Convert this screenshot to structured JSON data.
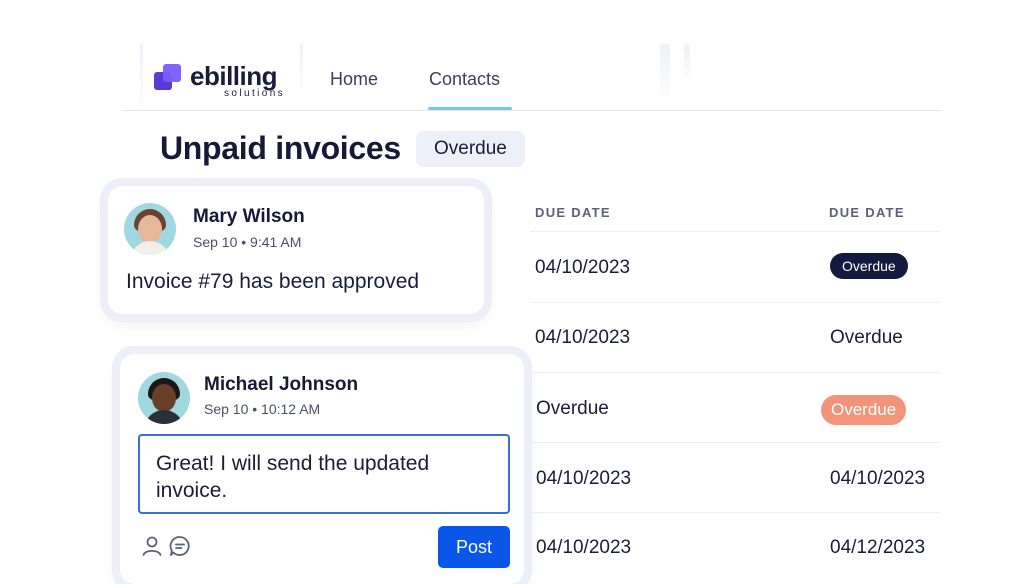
{
  "brand": {
    "name": "ebilling",
    "tagline": "solutions"
  },
  "nav": {
    "items": [
      "Home",
      "Contacts"
    ],
    "active": "Contacts"
  },
  "page": {
    "title": "Unpaid invoices",
    "filter_chip": "Overdue"
  },
  "table": {
    "columns": [
      "DUE DATE",
      "DUE DATE"
    ],
    "rows": [
      {
        "a": "04/10/2023",
        "b": "Overdue",
        "b_style": "dark-badge"
      },
      {
        "a": "04/10/2023",
        "b": "Overdue",
        "b_style": "plain"
      },
      {
        "a": "Overdue",
        "b": "Overdue",
        "b_style": "salmon-badge"
      },
      {
        "a": "04/10/2023",
        "b": "04/10/2023",
        "b_style": "plain"
      },
      {
        "a": "04/10/2023",
        "b": "04/12/2023",
        "b_style": "plain"
      }
    ]
  },
  "comments": [
    {
      "author": "Mary Wilson",
      "meta": "Sep 10 • 9:41 AM",
      "message": "Invoice #79 has been approved"
    },
    {
      "author": "Michael Johnson",
      "meta": "Sep 10 • 10:12 AM",
      "reply_text": "Great! I will send the updated invoice.",
      "post_label": "Post"
    }
  ],
  "icons": [
    "user-icon",
    "chat-icon"
  ],
  "colors": {
    "accent": "#0a56e8",
    "brand": "#5b3bd6",
    "tab_underline": "#79c4e8",
    "badge_dark": "#141a3d",
    "badge_salmon": "#f3937a"
  }
}
